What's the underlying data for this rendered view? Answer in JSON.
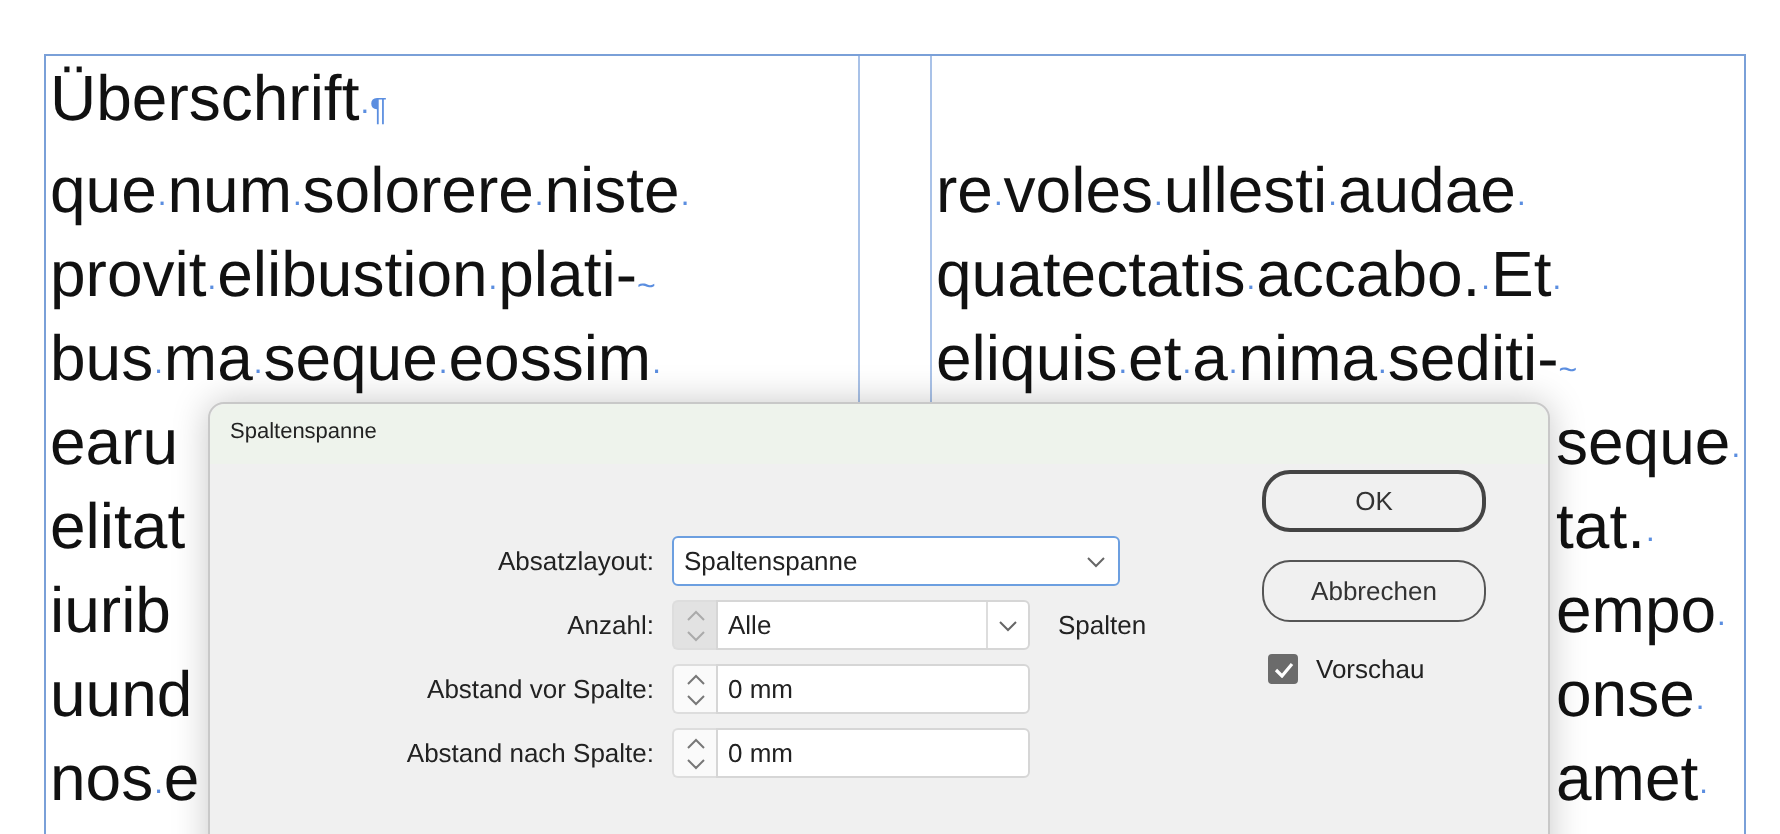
{
  "document": {
    "left_column": [
      "Überschrift·¶",
      "que·num·solorere·niste·",
      "provit·elibustion·plati-~",
      "bus·ma·seque·eossim·",
      "earu",
      "elitat",
      "iurib",
      "uund",
      "nos·e"
    ],
    "right_column": [
      {
        "text": "re·voles·ullesti·audae·",
        "kind": "full"
      },
      {
        "text": "quatectatis·accabo.·Et·",
        "kind": "full"
      },
      {
        "text": "eliquis·et·a·nima·sediti-~",
        "kind": "full"
      },
      {
        "text": "seque·",
        "kind": "tail"
      },
      {
        "text": "tat.·",
        "kind": "tail"
      },
      {
        "text": "empo·",
        "kind": "tail"
      },
      {
        "text": "onse·",
        "kind": "tail"
      },
      {
        "text": "amet·",
        "kind": "tail"
      }
    ]
  },
  "dialog": {
    "title": "Spaltenspanne",
    "rows": [
      {
        "label": "Absatzlayout:",
        "kind": "dropdown",
        "value": "Spaltenspanne"
      },
      {
        "label": "Anzahl:",
        "kind": "combo-spinner",
        "value": "Alle",
        "disabled": true,
        "suffix": "Spalten"
      },
      {
        "label": "Abstand vor Spalte:",
        "kind": "spinner",
        "value": "0 mm",
        "disabled": false
      },
      {
        "label": "Abstand nach Spalte:",
        "kind": "spinner",
        "value": "0 mm",
        "disabled": false
      }
    ],
    "buttons": [
      {
        "label": "OK",
        "default": true
      },
      {
        "label": "Abbrechen",
        "default": false
      }
    ],
    "preview": {
      "label": "Vorschau",
      "checked": true
    }
  }
}
